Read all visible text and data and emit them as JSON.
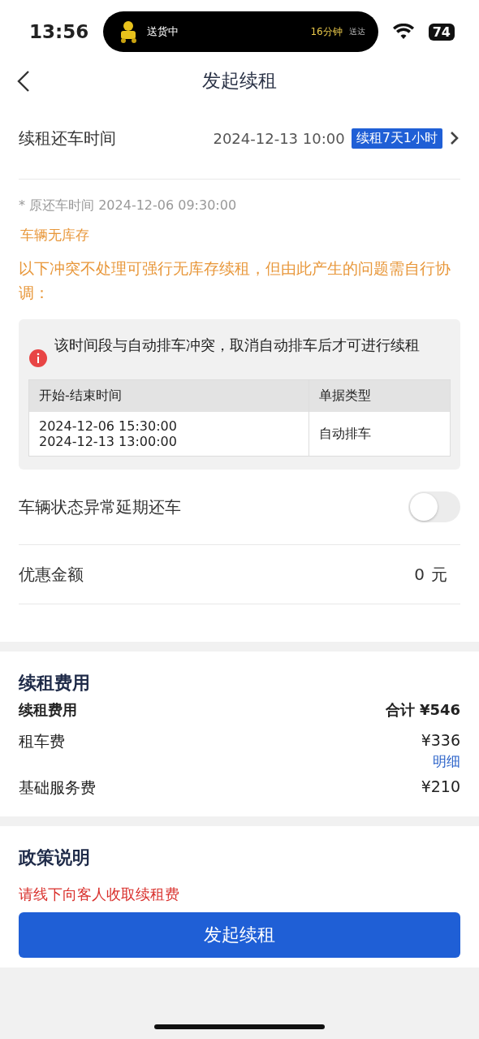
{
  "status_bar": {
    "time": "13:56",
    "activity": {
      "label": "送货中",
      "eta": "16分钟",
      "eta_suffix": "送达"
    },
    "battery": "74"
  },
  "nav": {
    "title": "发起续租"
  },
  "return_time": {
    "label": "续租还车时间",
    "value": "2024-12-13 10:00",
    "badge": "续租7天1小时"
  },
  "original_time": "* 原还车时间 2024-12-06 09:30:00",
  "stock_status": "车辆无库存",
  "warning": "以下冲突不处理可强行无库存续租，但由此产生的问题需自行协调：",
  "conflict": {
    "message": "该时间段与自动排车冲突，取消自动排车后才可进行续租",
    "columns": [
      "开始-结束时间",
      "单据类型"
    ],
    "rows": [
      {
        "time_lines": [
          "2024-12-06 15:30:00",
          "2024-12-13 13:00:00"
        ],
        "type": "自动排车"
      }
    ]
  },
  "delay_toggle": {
    "label": "车辆状态异常延期还车",
    "on": false
  },
  "discount": {
    "label": "优惠金额",
    "value": "0",
    "unit": "元"
  },
  "fees": {
    "title": "续租费用",
    "subtitle": "续租费用",
    "total": "合计 ¥546",
    "items": [
      {
        "label": "租车费",
        "amount": "¥336",
        "link": "明细"
      },
      {
        "label": "基础服务费",
        "amount": "¥210"
      }
    ]
  },
  "policy": {
    "title": "政策说明",
    "note": "请线下向客人收取续租费"
  },
  "submit": "发起续租"
}
